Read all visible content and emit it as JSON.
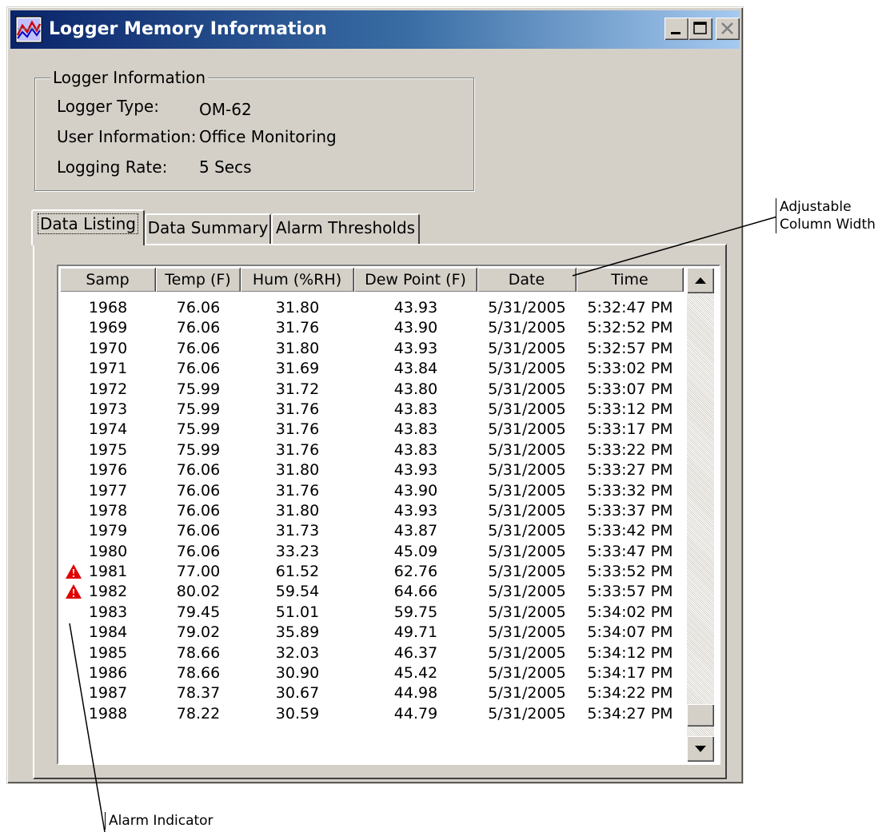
{
  "window": {
    "title": "Logger Memory Information"
  },
  "logger_info": {
    "group_title": "Logger Information",
    "fields": [
      {
        "label": "Logger Type:",
        "value": "OM-62"
      },
      {
        "label": "User Information:",
        "value": "Office Monitoring"
      },
      {
        "label": "Logging Rate:",
        "value": "5 Secs"
      }
    ]
  },
  "tabs": [
    {
      "label": "Data Listing",
      "active": true
    },
    {
      "label": "Data Summary",
      "active": false
    },
    {
      "label": "Alarm Thresholds",
      "active": false
    }
  ],
  "table": {
    "columns": [
      "Samp",
      "Temp (F)",
      "Hum (%RH)",
      "Dew Point (F)",
      "Date",
      "Time"
    ],
    "rows": [
      {
        "alarm": false,
        "cells": [
          "1968",
          "76.06",
          "31.80",
          "43.93",
          "5/31/2005",
          "5:32:47 PM"
        ]
      },
      {
        "alarm": false,
        "cells": [
          "1969",
          "76.06",
          "31.76",
          "43.90",
          "5/31/2005",
          "5:32:52 PM"
        ]
      },
      {
        "alarm": false,
        "cells": [
          "1970",
          "76.06",
          "31.80",
          "43.93",
          "5/31/2005",
          "5:32:57 PM"
        ]
      },
      {
        "alarm": false,
        "cells": [
          "1971",
          "76.06",
          "31.69",
          "43.84",
          "5/31/2005",
          "5:33:02 PM"
        ]
      },
      {
        "alarm": false,
        "cells": [
          "1972",
          "75.99",
          "31.72",
          "43.80",
          "5/31/2005",
          "5:33:07 PM"
        ]
      },
      {
        "alarm": false,
        "cells": [
          "1973",
          "75.99",
          "31.76",
          "43.83",
          "5/31/2005",
          "5:33:12 PM"
        ]
      },
      {
        "alarm": false,
        "cells": [
          "1974",
          "75.99",
          "31.76",
          "43.83",
          "5/31/2005",
          "5:33:17 PM"
        ]
      },
      {
        "alarm": false,
        "cells": [
          "1975",
          "75.99",
          "31.76",
          "43.83",
          "5/31/2005",
          "5:33:22 PM"
        ]
      },
      {
        "alarm": false,
        "cells": [
          "1976",
          "76.06",
          "31.80",
          "43.93",
          "5/31/2005",
          "5:33:27 PM"
        ]
      },
      {
        "alarm": false,
        "cells": [
          "1977",
          "76.06",
          "31.76",
          "43.90",
          "5/31/2005",
          "5:33:32 PM"
        ]
      },
      {
        "alarm": false,
        "cells": [
          "1978",
          "76.06",
          "31.80",
          "43.93",
          "5/31/2005",
          "5:33:37 PM"
        ]
      },
      {
        "alarm": false,
        "cells": [
          "1979",
          "76.06",
          "31.73",
          "43.87",
          "5/31/2005",
          "5:33:42 PM"
        ]
      },
      {
        "alarm": false,
        "cells": [
          "1980",
          "76.06",
          "33.23",
          "45.09",
          "5/31/2005",
          "5:33:47 PM"
        ]
      },
      {
        "alarm": true,
        "cells": [
          "1981",
          "77.00",
          "61.52",
          "62.76",
          "5/31/2005",
          "5:33:52 PM"
        ]
      },
      {
        "alarm": true,
        "cells": [
          "1982",
          "80.02",
          "59.54",
          "64.66",
          "5/31/2005",
          "5:33:57 PM"
        ]
      },
      {
        "alarm": false,
        "cells": [
          "1983",
          "79.45",
          "51.01",
          "59.75",
          "5/31/2005",
          "5:34:02 PM"
        ]
      },
      {
        "alarm": false,
        "cells": [
          "1984",
          "79.02",
          "35.89",
          "49.71",
          "5/31/2005",
          "5:34:07 PM"
        ]
      },
      {
        "alarm": false,
        "cells": [
          "1985",
          "78.66",
          "32.03",
          "46.37",
          "5/31/2005",
          "5:34:12 PM"
        ]
      },
      {
        "alarm": false,
        "cells": [
          "1986",
          "78.66",
          "30.90",
          "45.42",
          "5/31/2005",
          "5:34:17 PM"
        ]
      },
      {
        "alarm": false,
        "cells": [
          "1987",
          "78.37",
          "30.67",
          "44.98",
          "5/31/2005",
          "5:34:22 PM"
        ]
      },
      {
        "alarm": false,
        "cells": [
          "1988",
          "78.22",
          "30.59",
          "44.79",
          "5/31/2005",
          "5:34:27 PM"
        ]
      }
    ]
  },
  "callouts": {
    "column_width_line1": "Adjustable",
    "column_width_line2": "Column Width",
    "alarm_indicator": "Alarm Indicator"
  },
  "icons": {
    "app": "logger-app-icon",
    "minimize": "minimize-icon",
    "maximize": "maximize-icon",
    "close": "close-icon",
    "alarm": "alarm-warning-icon",
    "scroll_up": "scroll-up-arrow-icon",
    "scroll_down": "scroll-down-arrow-icon"
  },
  "colors": {
    "title_gradient_start": "#0a246a",
    "title_gradient_end": "#a6caf0",
    "window_face": "#d4d0c8",
    "alarm_red": "#e00000"
  }
}
